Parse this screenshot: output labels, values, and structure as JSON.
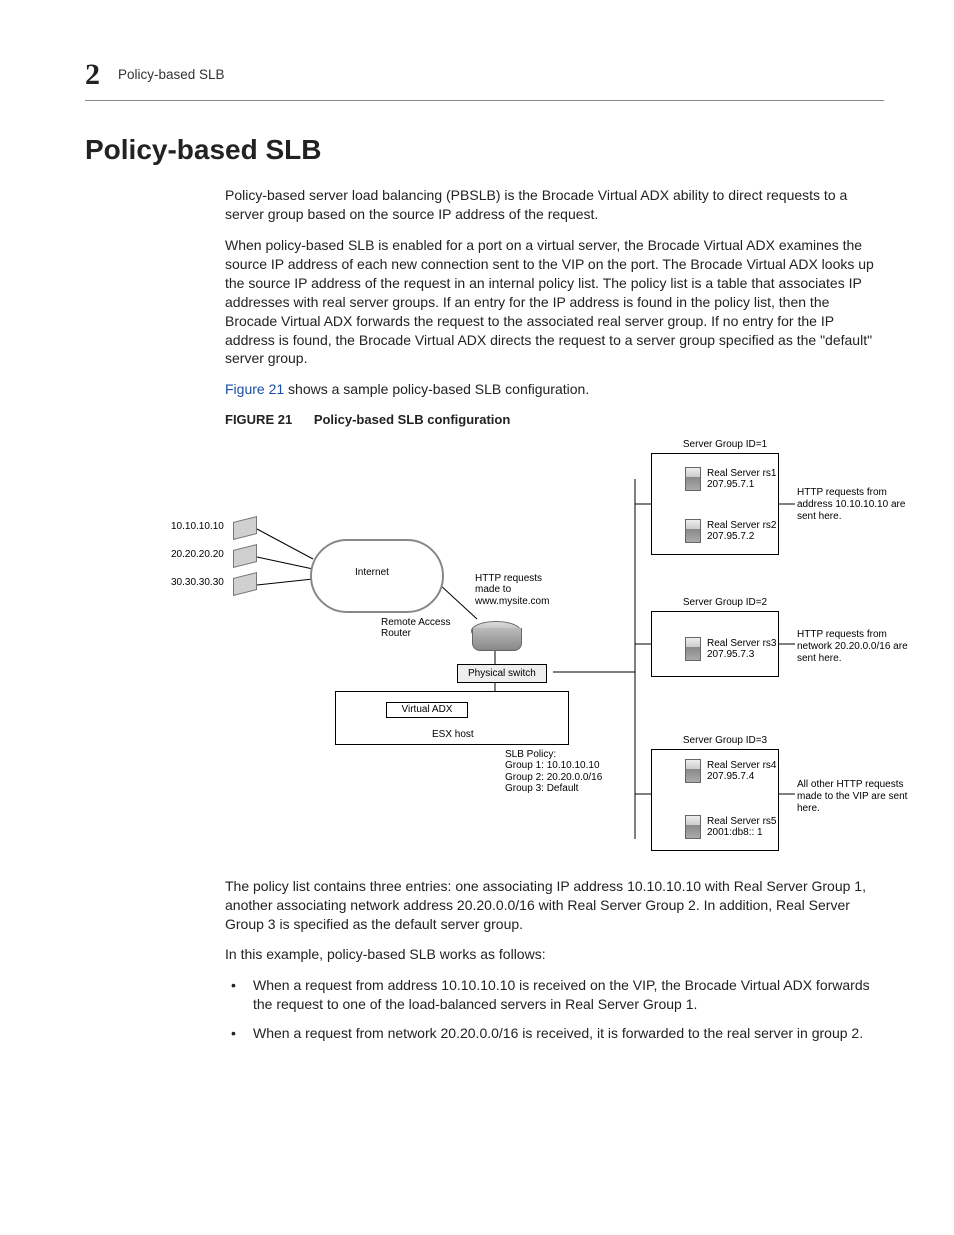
{
  "header": {
    "section_number": "2",
    "running_title": "Policy-based SLB"
  },
  "title": "Policy-based SLB",
  "paragraphs": {
    "p1": "Policy-based server load balancing (PBSLB) is the Brocade Virtual ADX ability to direct requests to a server group based on the source IP address of the request.",
    "p2": "When policy-based SLB is enabled for a port on a virtual server, the Brocade Virtual ADX examines the source IP address of each new connection sent to the VIP on the port. The Brocade Virtual ADX looks up the source IP address of the request in an internal policy list. The policy list is a table that associates IP addresses with real server groups. If an entry for the IP address is found in the policy list, then the Brocade Virtual ADX forwards the request to the associated real server group. If no entry for the IP address is found, the Brocade Virtual ADX directs the request to a server group specified as the \"default\" server group.",
    "fig_link": "Figure 21",
    "fig_link_tail": " shows a sample policy-based SLB configuration.",
    "fig_cap_label": "FIGURE 21",
    "fig_cap_text": "Policy-based SLB configuration",
    "p3": "The policy list contains three entries: one associating IP address 10.10.10.10 with Real Server Group 1, another associating network address 20.20.0.0/16 with Real Server Group 2. In addition, Real Server Group 3 is specified as the default server group.",
    "p4": "In this example, policy-based SLB works as follows:",
    "b1": "When a request from address 10.10.10.10 is received on the VIP, the Brocade Virtual ADX forwards the request to one of the load-balanced servers in Real Server Group 1.",
    "b2": "When a request from network 20.20.0.0/16 is received, it is forwarded to the real server in group 2."
  },
  "diagram": {
    "clients": [
      "10.10.10.10",
      "20.20.20.20",
      "30.30.30.30"
    ],
    "internet": "Internet",
    "http_req": "HTTP requests\nmade to\nwww.mysite.com",
    "rar": "Remote Access\nRouter",
    "phys_switch": "Physical switch",
    "virtual_adx": "Virtual ADX",
    "esx_host": "ESX host",
    "slb_policy_title": "SLB Policy:",
    "slb_policy_lines": [
      "Group 1: 10.10.10.10",
      "Group 2: 20.20.0.0/16",
      "Group 3: Default"
    ],
    "groups": [
      {
        "title": "Server Group ID=1",
        "servers": [
          {
            "name": "Real Server rs1",
            "ip": "207.95.7.1"
          },
          {
            "name": "Real Server rs2",
            "ip": "207.95.7.2"
          }
        ],
        "annotation": "HTTP requests from address 10.10.10.10 are sent here."
      },
      {
        "title": "Server Group ID=2",
        "servers": [
          {
            "name": "Real Server rs3",
            "ip": "207.95.7.3"
          }
        ],
        "annotation": "HTTP requests from network 20.20.0.0/16 are sent here."
      },
      {
        "title": "Server Group ID=3",
        "servers": [
          {
            "name": "Real Server rs4",
            "ip": "207.95.7.4"
          },
          {
            "name": "Real Server rs5",
            "ip": "2001:db8:: 1"
          }
        ],
        "annotation": "All other HTTP requests made to the VIP are sent here."
      }
    ]
  }
}
